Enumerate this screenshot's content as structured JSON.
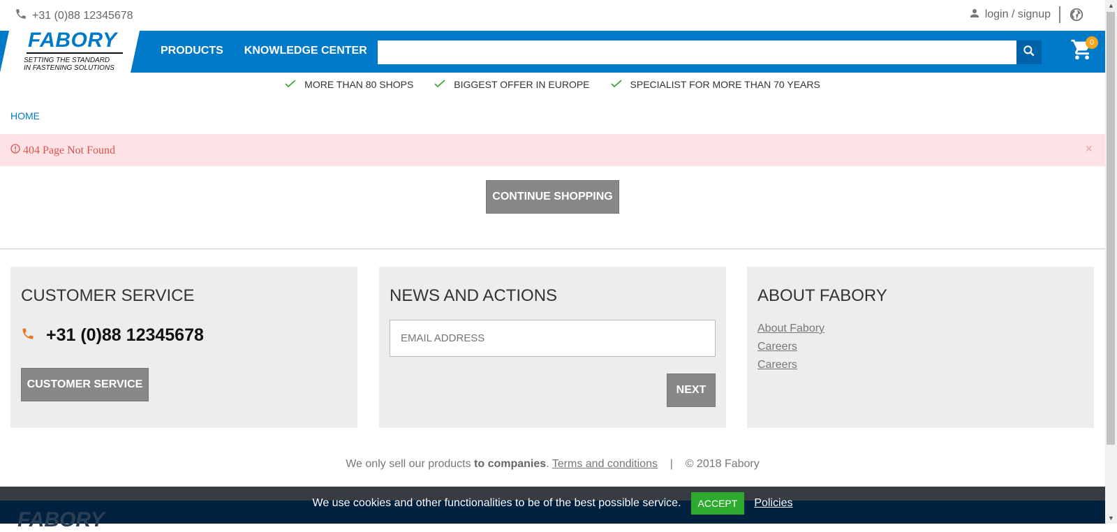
{
  "topbar": {
    "phone": "+31 (0)88 12345678",
    "login": "login / signup"
  },
  "header": {
    "logo_word": "FABORY",
    "logo_tag_1": "SETTING THE STANDARD",
    "logo_tag_2": "IN FASTENING SOLUTIONS",
    "nav": [
      "PRODUCTS",
      "KNOWLEDGE CENTER"
    ],
    "search_placeholder": "",
    "cart_count": "0"
  },
  "usps": [
    "MORE THAN 80 SHOPS",
    "BIGGEST OFFER IN EUROPE",
    "SPECIALIST FOR MORE THAN 70 YEARS"
  ],
  "breadcrumb": "HOME",
  "alert": {
    "message": "404 Page Not Found",
    "close": "×"
  },
  "continue_label": "CONTINUE SHOPPING",
  "customer_service": {
    "title": "CUSTOMER SERVICE",
    "phone": "+31 (0)88 12345678",
    "button": "CUSTOMER SERVICE"
  },
  "news": {
    "title": "NEWS AND ACTIONS",
    "email_placeholder": "EMAIL ADDRESS",
    "button": "NEXT"
  },
  "about": {
    "title": "ABOUT FABORY",
    "links": [
      "About Fabory",
      "Careers",
      "Careers"
    ]
  },
  "legal": {
    "prefix": "We only sell our products ",
    "bold": "to companies",
    "dot": ". ",
    "terms": "Terms and conditions",
    "sep": "|",
    "copyright": "© 2018 Fabory"
  },
  "cookie": {
    "text": "We use cookies and other functionalities to be of the best possible service.",
    "accept": "ACCEPT",
    "policies": "Policies"
  },
  "footer_logo": "FABORY",
  "colors": {
    "brand_blue": "#0079c8",
    "alert_bg": "#fde3e5",
    "accept_green": "#2eaa2e",
    "cart_badge": "#f7a51c",
    "phone_icon": "#e87722"
  }
}
